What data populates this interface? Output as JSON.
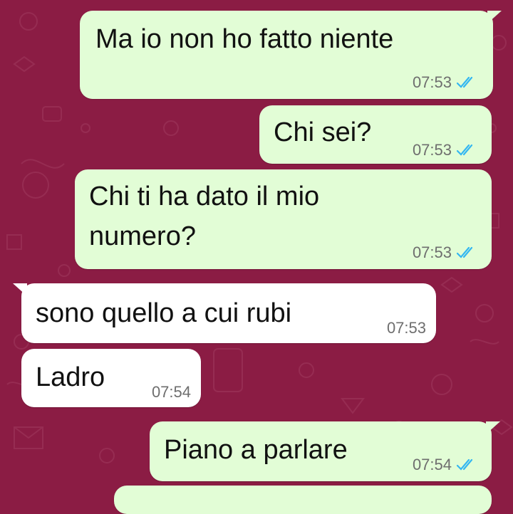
{
  "colors": {
    "wallpaper": "#8b1c44",
    "outgoing_bubble": "#e2fdd6",
    "incoming_bubble": "#ffffff",
    "read_ticks": "#34b7f1"
  },
  "messages": [
    {
      "direction": "outgoing",
      "text": "Ma io non ho fatto niente",
      "time": "07:53",
      "status_icon": "double-check-read-icon"
    },
    {
      "direction": "outgoing",
      "text": "Chi sei?",
      "time": "07:53",
      "status_icon": "double-check-read-icon"
    },
    {
      "direction": "outgoing",
      "text_lines": [
        "Chi ti ha dato il mio",
        "numero?"
      ],
      "time": "07:53",
      "status_icon": "double-check-read-icon"
    },
    {
      "direction": "incoming",
      "text": "sono quello a cui rubi",
      "time": "07:53"
    },
    {
      "direction": "incoming",
      "text": "Ladro",
      "time": "07:54"
    },
    {
      "direction": "outgoing",
      "text": "Piano a parlare",
      "time": "07:54",
      "status_icon": "double-check-read-icon"
    }
  ]
}
